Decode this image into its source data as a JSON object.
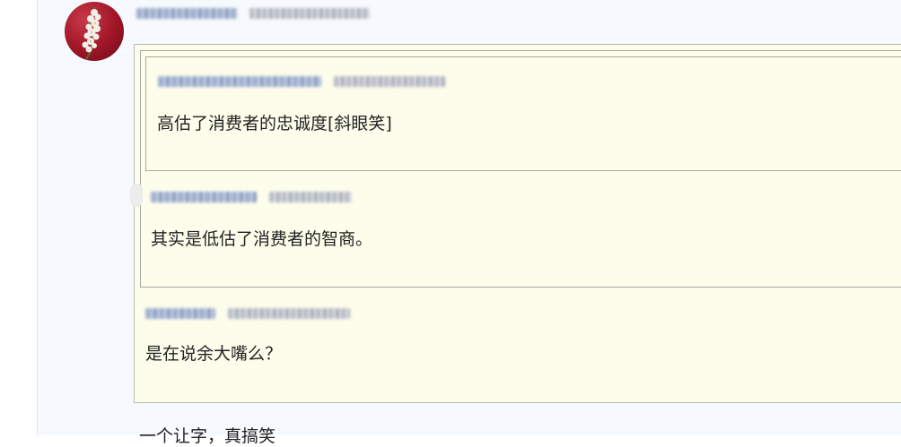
{
  "post": {
    "avatar_icon": "flower-avatar-icon"
  },
  "thread": {
    "quote_level_3": {
      "text": "高估了消费者的忠诚度[斜眼笑]"
    },
    "quote_level_2": {
      "text": "其实是低估了消费者的智商。"
    },
    "quote_level_1": {
      "text": "是在说余大嘴么？"
    },
    "reply_text": "一个让字，真搞笑"
  },
  "colors": {
    "quote_background": "#fdfdec",
    "quote_border": "#b9b9b0",
    "page_background": "#f6f9fd"
  }
}
